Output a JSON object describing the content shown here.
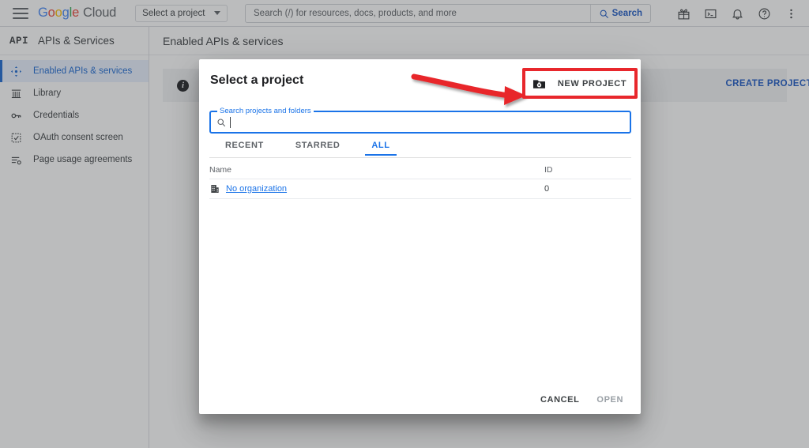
{
  "topbar": {
    "menu_icon": "hamburger-menu-icon",
    "logo": {
      "google": "Google",
      "cloud": "Cloud"
    },
    "project_picker_label": "Select a project",
    "search": {
      "placeholder": "Search (/) for resources, docs, products, and more",
      "value": "",
      "button_label": "Search",
      "icon": "search-icon"
    },
    "icons": [
      {
        "name": "gift-icon",
        "glyph": "gift"
      },
      {
        "name": "cloud-shell-icon",
        "glyph": "terminal"
      },
      {
        "name": "notifications-bell-icon",
        "glyph": "bell"
      },
      {
        "name": "help-icon",
        "glyph": "question-circle"
      },
      {
        "name": "more-options-icon",
        "glyph": "kebab"
      }
    ]
  },
  "sidebar": {
    "product_logo": "API",
    "product_title": "APIs & Services",
    "items": [
      {
        "label": "Enabled APIs & services",
        "icon": "hub-icon",
        "active": true
      },
      {
        "label": "Library",
        "icon": "library-icon",
        "active": false
      },
      {
        "label": "Credentials",
        "icon": "key-icon",
        "active": false
      },
      {
        "label": "OAuth consent screen",
        "icon": "consent-screen-icon",
        "active": false
      },
      {
        "label": "Page usage agreements",
        "icon": "page-agreements-icon",
        "active": false
      }
    ]
  },
  "main": {
    "page_title": "Enabled APIs & services",
    "info_icon": "info-icon",
    "info_glyph": "i",
    "create_project_label": "CREATE PROJECT"
  },
  "dialog": {
    "title": "Select a project",
    "new_project_button": {
      "label": "NEW PROJECT",
      "icon": "create-new-folder-icon"
    },
    "search_field": {
      "label": "Search projects and folders",
      "value": "",
      "icon": "search-icon"
    },
    "tabs": [
      {
        "label": "RECENT",
        "active": false
      },
      {
        "label": "STARRED",
        "active": false
      },
      {
        "label": "ALL",
        "active": true
      }
    ],
    "table": {
      "columns": [
        "Name",
        "ID"
      ],
      "rows": [
        {
          "name": "No organization",
          "id": "0",
          "icon": "organization-building-icon"
        }
      ]
    },
    "footer": {
      "cancel_label": "CANCEL",
      "open_label": "OPEN"
    }
  },
  "annotations": {
    "highlight_color": "#e8272c",
    "arrow": {
      "name": "red-curved-arrow",
      "points_to": "NEW PROJECT"
    },
    "highlight_box": {
      "name": "red-highlight-box",
      "target": "NEW PROJECT"
    }
  },
  "colors": {
    "accent_blue": "#1a73e8",
    "link_blue": "#1a56c4",
    "annotation_red": "#e8272c",
    "scrim": "#3c4043",
    "sidebar_active_bg": "#e8f0fe"
  }
}
